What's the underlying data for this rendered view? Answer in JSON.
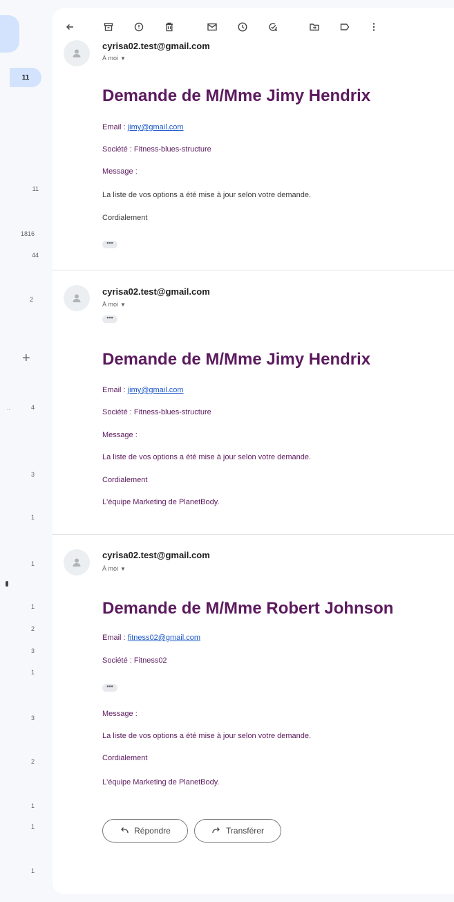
{
  "sidebar": {
    "counts": [
      "11",
      "11",
      "1816",
      "44",
      "2",
      "4",
      "3",
      "1",
      "1",
      "1",
      "2",
      "3",
      "1",
      "3",
      "2",
      "1",
      "1",
      "1"
    ]
  },
  "toolbar": {
    "icons": [
      "back-arrow-icon",
      "archive-icon",
      "report-spam-icon",
      "delete-icon",
      "mark-unread-icon",
      "snooze-icon",
      "add-task-icon",
      "move-to-icon",
      "label-icon",
      "more-vert-icon"
    ]
  },
  "messages": [
    {
      "sender": "cyrisa02.test@gmail.com",
      "recipient": "À moi",
      "subject": "Demande de M/Mme Jimy Hendrix",
      "email_label": "Email : ",
      "email": "jimy@gmail.com",
      "company": "Société : Fitness-blues-structure",
      "message_label": "Message :",
      "body": "La liste de vos options a été mise à jour selon votre demande.",
      "closing": "Cordialement",
      "ellipsis": "•••"
    },
    {
      "sender": "cyrisa02.test@gmail.com",
      "recipient": "À moi",
      "subject": "Demande de M/Mme Jimy Hendrix",
      "email_label": "Email : ",
      "email": "jimy@gmail.com",
      "company": "Société : Fitness-blues-structure",
      "message_label": "Message :",
      "body": "La liste de vos options a été mise à jour selon votre demande.",
      "closing": "Cordialement",
      "signature": "L'équipe Marketing de PlanetBody.",
      "ellipsis": "•••"
    },
    {
      "sender": "cyrisa02.test@gmail.com",
      "recipient": "À moi",
      "subject": "Demande de M/Mme Robert Johnson",
      "email_label": "Email : ",
      "email": "fitness02@gmail.com",
      "company": "Société : Fitness02",
      "message_label": "Message :",
      "body": "La liste de vos options a été mise à jour selon votre demande.",
      "closing": "Cordialement",
      "signature": "L'équipe Marketing de PlanetBody.",
      "ellipsis": "•••"
    }
  ],
  "actions": {
    "reply_label": "Répondre",
    "forward_label": "Transférer"
  },
  "colors": {
    "subject": "#5b1a5e",
    "link": "#1a56c9",
    "sidebar_active": "#d3e3fd"
  }
}
